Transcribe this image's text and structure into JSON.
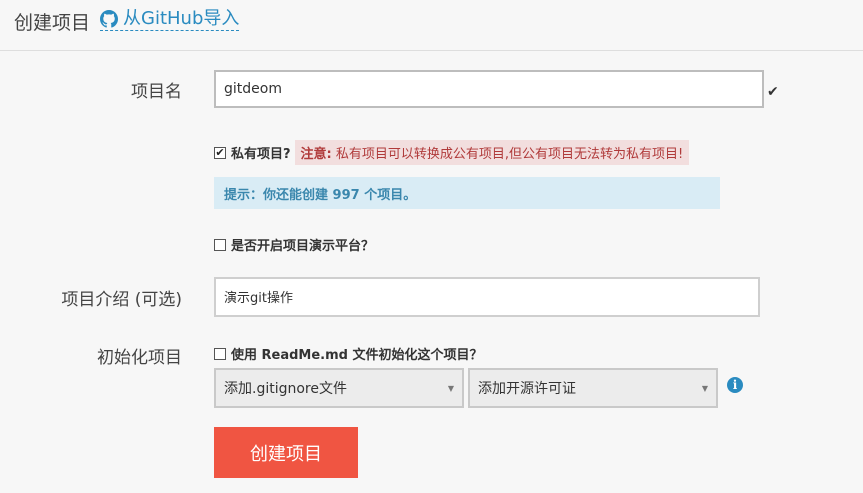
{
  "header": {
    "title": "创建项目",
    "import_link": "从GitHub导入"
  },
  "form": {
    "name": {
      "label": "项目名",
      "value": "gitdeom"
    },
    "private": {
      "label": "私有项目?",
      "checked": true,
      "warn_title": "注意:",
      "warn_text": "私有项目可以转换成公有项目,但公有项目无法转为私有项目!"
    },
    "hint": "提示：你还能创建 997 个项目。",
    "demo": {
      "label": "是否开启项目演示平台？",
      "checked": false
    },
    "description": {
      "label": "项目介绍 (可选)",
      "value": "演示git操作"
    },
    "init": {
      "label": "初始化项目",
      "readme_label": "使用 ReadMe.md 文件初始化这个项目？",
      "readme_checked": false,
      "gitignore_select": "添加.gitignore文件",
      "license_select": "添加开源许可证"
    },
    "submit": "创建项目"
  },
  "icons": {
    "github": "github-icon",
    "valid": "checkmark-icon",
    "info": "info-icon"
  },
  "colors": {
    "accent": "#2a8bc0",
    "submit": "#f05542",
    "warn_bg": "#f2dede",
    "hint_bg": "#d9ecf5"
  }
}
